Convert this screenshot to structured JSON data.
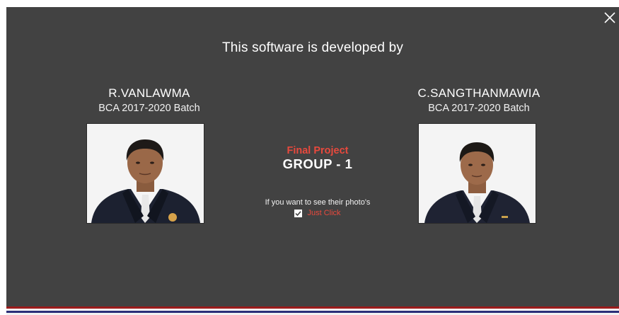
{
  "window": {
    "close_icon": "close-icon"
  },
  "heading": "This software is developed by",
  "developers": [
    {
      "name": "R.VANLAWMA",
      "batch": "BCA 2017-2020 Batch",
      "photo_icon": "developer-photo"
    },
    {
      "name": "C.SANGTHANMAWIA",
      "batch": "BCA 2017-2020 Batch",
      "photo_icon": "developer-photo"
    }
  ],
  "project": {
    "label": "Final Project",
    "group": "GROUP - 1"
  },
  "photo_prompt": {
    "hint": "If you want to see their photo's",
    "checkbox_checked": true,
    "link_label": "Just Click"
  },
  "colors": {
    "background": "#424242",
    "accent_red": "#e8493d",
    "text": "#ffffff",
    "stripe_red": "#9b1c1c",
    "stripe_white": "#f2f2f2",
    "stripe_navy": "#2b2e78"
  }
}
